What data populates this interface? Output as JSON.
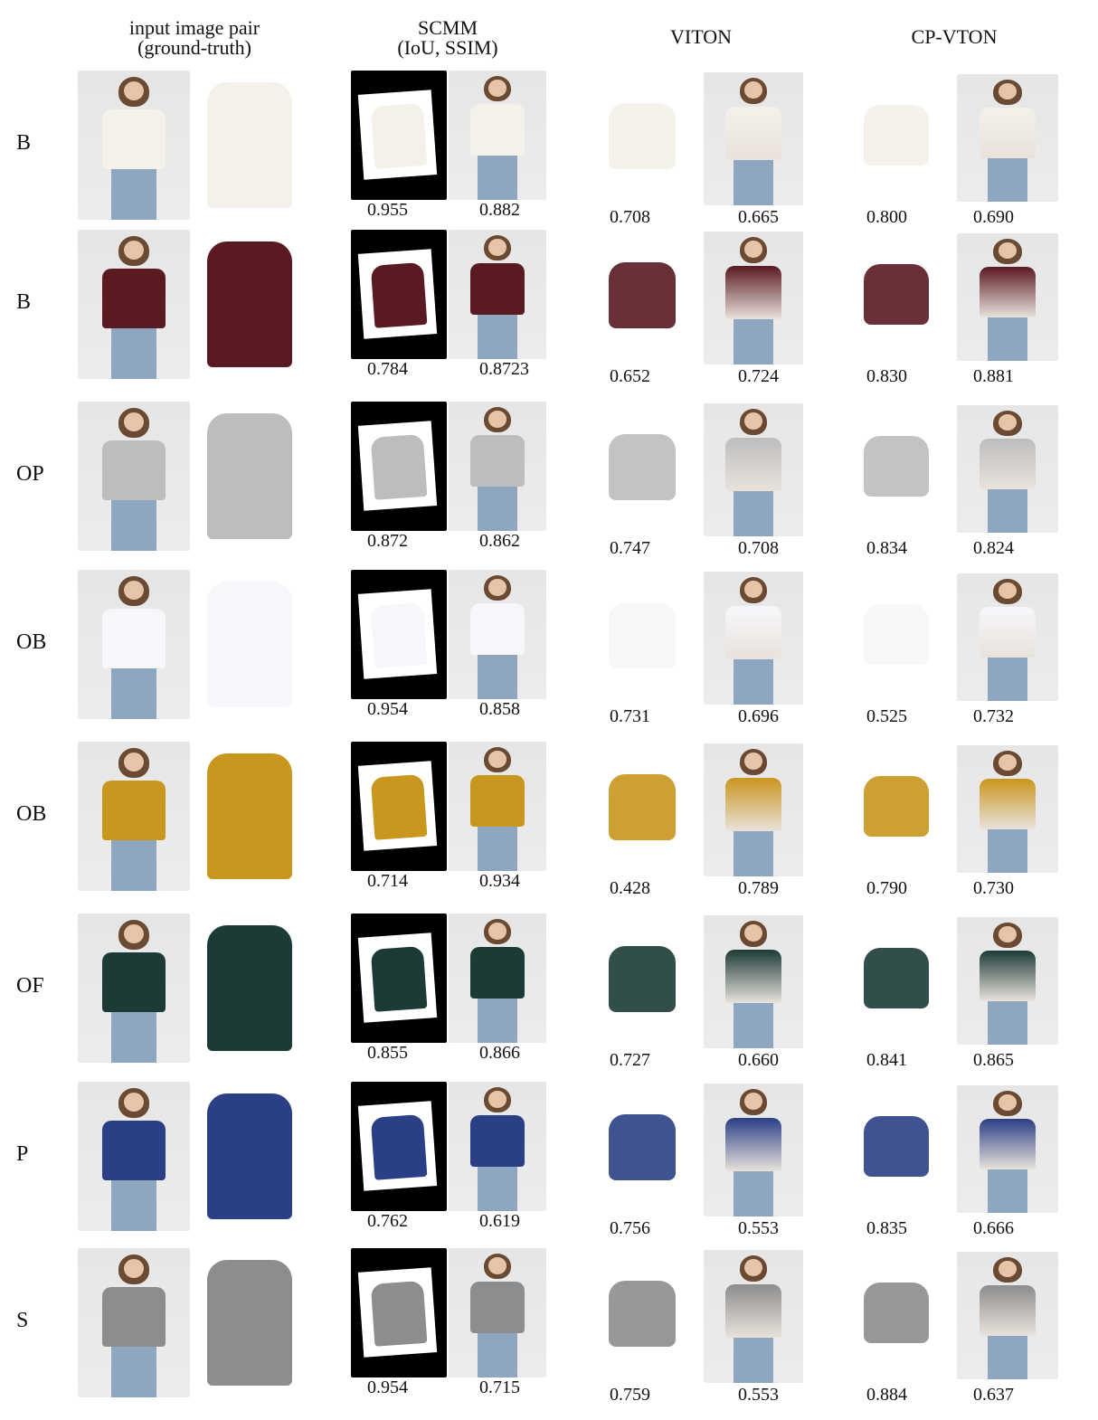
{
  "headers": {
    "input_line1": "input image pair",
    "input_line2": "(ground-truth)",
    "scmm_line1": "SCMM",
    "scmm_line2": "(IoU, SSIM)",
    "viton": "VITON",
    "cpvton": "CP-VTON"
  },
  "rows": [
    {
      "label": "B",
      "scmm_iou": "0.955",
      "scmm_ssim": "0.882",
      "viton_iou": "0.708",
      "viton_ssim": "0.665",
      "cp_iou": "0.800",
      "cp_ssim": "0.690",
      "color": "#f4f1ea"
    },
    {
      "label": "B",
      "scmm_iou": "0.784",
      "scmm_ssim": "0.8723",
      "viton_iou": "0.652",
      "viton_ssim": "0.724",
      "cp_iou": "0.830",
      "cp_ssim": "0.881",
      "color": "#5a1a22"
    },
    {
      "label": "OP",
      "scmm_iou": "0.872",
      "scmm_ssim": "0.862",
      "viton_iou": "0.747",
      "viton_ssim": "0.708",
      "cp_iou": "0.834",
      "cp_ssim": "0.824",
      "color": "#bdbdbd"
    },
    {
      "label": "OB",
      "scmm_iou": "0.954",
      "scmm_ssim": "0.858",
      "viton_iou": "0.731",
      "viton_ssim": "0.696",
      "cp_iou": "0.525",
      "cp_ssim": "0.732",
      "color": "#f7f7fb"
    },
    {
      "label": "OB",
      "scmm_iou": "0.714",
      "scmm_ssim": "0.934",
      "viton_iou": "0.428",
      "viton_ssim": "0.789",
      "cp_iou": "0.790",
      "cp_ssim": "0.730",
      "color": "#c9961e"
    },
    {
      "label": "OF",
      "scmm_iou": "0.855",
      "scmm_ssim": "0.866",
      "viton_iou": "0.727",
      "viton_ssim": "0.660",
      "cp_iou": "0.841",
      "cp_ssim": "0.865",
      "color": "#1c3b37"
    },
    {
      "label": "P",
      "scmm_iou": "0.762",
      "scmm_ssim": "0.619",
      "viton_iou": "0.756",
      "viton_ssim": "0.553",
      "cp_iou": "0.835",
      "cp_ssim": "0.666",
      "color": "#2b3f86"
    },
    {
      "label": "S",
      "scmm_iou": "0.954",
      "scmm_ssim": "0.715",
      "viton_iou": "0.759",
      "viton_ssim": "0.553",
      "cp_iou": "0.884",
      "cp_ssim": "0.637",
      "color": "#8d8d8d"
    }
  ]
}
